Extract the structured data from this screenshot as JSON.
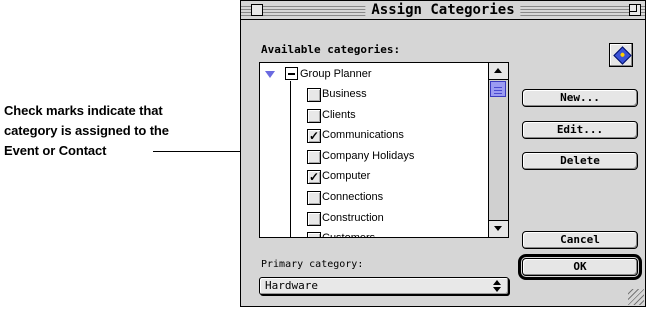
{
  "callout": {
    "lines": [
      "Check marks indicate that",
      "category is assigned to the",
      "Event or Contact"
    ]
  },
  "dialog": {
    "title": "Assign Categories",
    "available_label": "Available categories:",
    "tree": {
      "root": "Group Planner",
      "items": [
        {
          "label": "Business",
          "checked": false
        },
        {
          "label": "Clients",
          "checked": false
        },
        {
          "label": "Communications",
          "checked": true
        },
        {
          "label": "Company Holidays",
          "checked": false
        },
        {
          "label": "Computer",
          "checked": true
        },
        {
          "label": "Connections",
          "checked": false
        },
        {
          "label": "Construction",
          "checked": false
        },
        {
          "label": "Customers",
          "checked": false
        }
      ]
    },
    "buttons": {
      "new": "New...",
      "edit": "Edit...",
      "delete": "Delete",
      "cancel": "Cancel",
      "ok": "OK"
    },
    "primary_category_label": "Primary category:",
    "primary_category_value": "Hardware"
  },
  "colors": {
    "accent": "#6a6ae0",
    "scroll_thumb": "#9b9bf2",
    "dialog_bg": "#d6d6d6"
  },
  "icons": [
    "disclosure-triangle-icon",
    "help-gem-icon",
    "checkmark-icon",
    "popup-arrows-icon",
    "grow-box-icon"
  ]
}
